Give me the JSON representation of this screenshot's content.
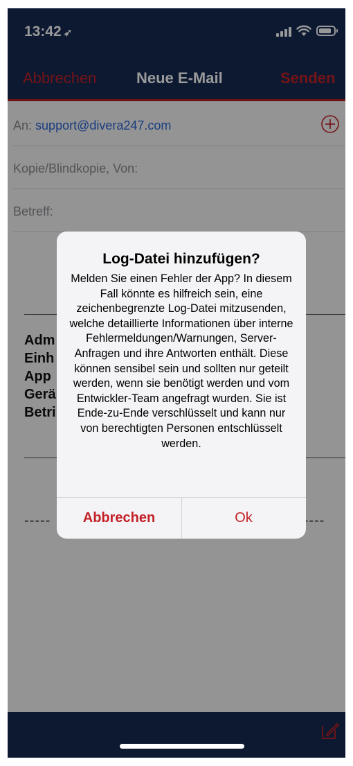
{
  "status": {
    "time": "13:42",
    "location_icon": "location-arrow-icon"
  },
  "nav": {
    "cancel_label": "Abbrechen",
    "title": "Neue E-Mail",
    "send_label": "Senden"
  },
  "form": {
    "to_label": "An:",
    "to_value": "support@divera247.com",
    "cc_label": "Kopie/Blindkopie, Von:",
    "subject_label": "Betreff:"
  },
  "body": {
    "lines": [
      "Adm",
      "Einh",
      "App",
      "Gerä",
      "Betri"
    ],
    "dashes_left": "-----",
    "dashes_right": "-----"
  },
  "alert": {
    "title": "Log-Datei hinzufügen?",
    "message": "Melden Sie einen Fehler der App? In diesem Fall könnte es hilfreich sein, eine zeichenbegrenzte Log-Datei mitzusenden, welche detaillierte Informationen über interne Fehlermeldungen/Warnungen, Server-Anfragen und ihre Antworten enthält. Diese können sensibel sein und sollten nur geteilt werden, wenn sie benötigt werden und vom Entwickler-Team angefragt wurden. Sie ist Ende-zu-Ende verschlüsselt und kann nur von berechtigten Personen entschlüsselt werden.",
    "cancel_label": "Abbrechen",
    "ok_label": "Ok"
  },
  "colors": {
    "nav_bg": "#142b52",
    "accent_red": "#c32127",
    "link_blue": "#2a66d2"
  }
}
